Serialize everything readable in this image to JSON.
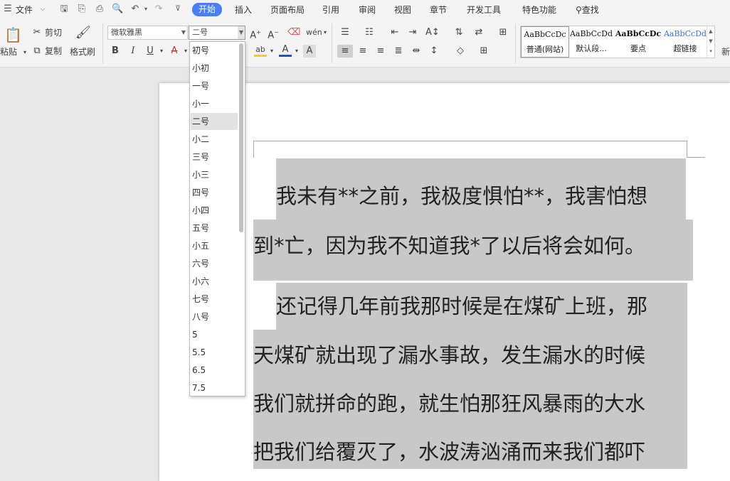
{
  "menubar": {
    "file_label": "文件",
    "tabs": [
      "开始",
      "插入",
      "页面布局",
      "引用",
      "审阅",
      "视图",
      "章节",
      "开发工具",
      "特色功能"
    ],
    "active_tab": "开始",
    "search_label": "查找"
  },
  "ribbon": {
    "paste_label": "粘贴",
    "cut_label": "剪切",
    "copy_label": "复制",
    "format_painter_label": "格式刷",
    "font_name": "微软雅黑",
    "font_size": "二号",
    "new_label": "新",
    "styles": [
      {
        "sample": "AaBbCcDc",
        "name": "普通(网站)"
      },
      {
        "sample": "AaBbCcDd",
        "name": "默认段..."
      },
      {
        "sample": "AaBbCcDc",
        "name": "要点"
      },
      {
        "sample": "AaBbCcDd",
        "name": "超链接"
      }
    ],
    "accent_color": "#4a7ef6",
    "font_color": "#1f4fe0",
    "highlight_color": "#f5d100"
  },
  "dropdown": {
    "items": [
      "初号",
      "小初",
      "一号",
      "小一",
      "二号",
      "小二",
      "三号",
      "小三",
      "四号",
      "小四",
      "五号",
      "小五",
      "六号",
      "小六",
      "七号",
      "八号",
      "5",
      "5.5",
      "6.5",
      "7.5"
    ],
    "selected": "二号"
  },
  "document": {
    "para1_line1": "我未有**之前，我极度惧怕**，我害怕想",
    "para1_line2": "到*亡，因为我不知道我*了以后将会如何。",
    "para2_line1": "还记得几年前我那时候是在煤矿上班，那",
    "para2_line2": "天煤矿就出现了漏水事故，发生漏水的时候",
    "para2_line3": "我们就拼命的跑，就生怕那狂风暴雨的大水",
    "para2_line4": "把我们给覆灭了，水波涛汹涌而来我们都吓"
  }
}
